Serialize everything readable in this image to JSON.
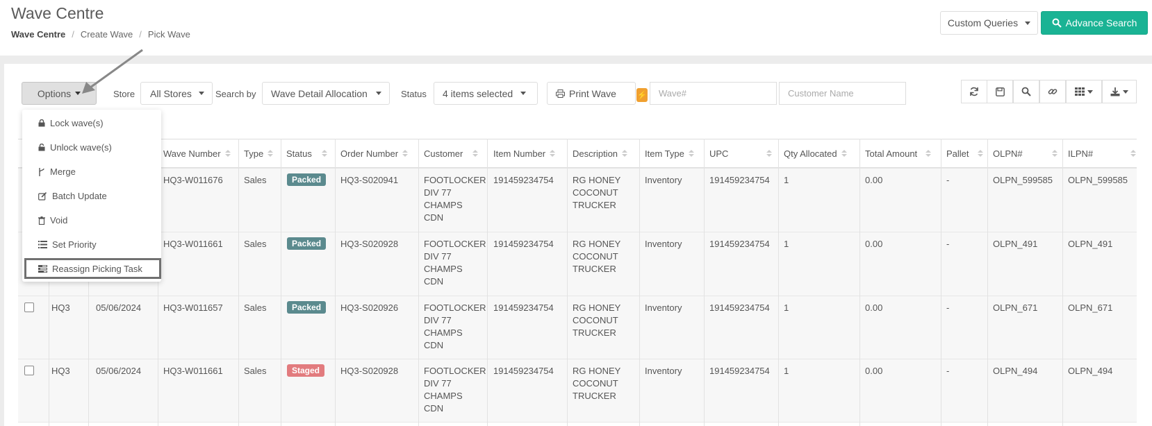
{
  "header": {
    "title": "Wave Centre",
    "breadcrumb": [
      "Wave Centre",
      "Create Wave",
      "Pick Wave"
    ],
    "custom_queries_label": "Custom Queries",
    "advance_search_label": "Advance Search"
  },
  "toolbar": {
    "options_label": "Options",
    "store_label": "Store",
    "store_value": "All Stores",
    "search_by_label": "Search by",
    "search_by_value": "Wave Detail Allocation",
    "status_label": "Status",
    "status_value": "4 items selected",
    "print_wave_label": "Print Wave",
    "wave_placeholder": "Wave#",
    "customer_placeholder": "Customer Name"
  },
  "options_menu": [
    {
      "label": "Lock wave(s)",
      "icon": "lock-icon"
    },
    {
      "label": "Unlock wave(s)",
      "icon": "unlock-icon"
    },
    {
      "label": "Merge",
      "icon": "merge-icon"
    },
    {
      "label": "Batch Update",
      "icon": "edit-icon"
    },
    {
      "label": "Void",
      "icon": "trash-icon"
    },
    {
      "label": "Set Priority",
      "icon": "list-icon"
    },
    {
      "label": "Reassign Picking Task",
      "icon": "tasks-icon"
    }
  ],
  "table": {
    "columns": [
      "Wave Number",
      "Type",
      "Status",
      "Order Number",
      "Customer",
      "Item Number",
      "Description",
      "Item Type",
      "UPC",
      "Qty Allocated",
      "Total Amount",
      "Pallet",
      "OLPN#",
      "ILPN#"
    ],
    "rows": [
      {
        "store": "",
        "date": "",
        "wave": "HQ3-W011676",
        "type": "Sales",
        "status": "Packed",
        "order": "HQ3-S020941",
        "customer": [
          "FOOTLOCKER",
          "DIV 77",
          "CHAMPS",
          "CDN"
        ],
        "item": "191459234754",
        "description": [
          "RG HONEY",
          "COCONUT",
          "TRUCKER"
        ],
        "item_type": "Inventory",
        "upc": "191459234754",
        "qty": "1",
        "amount": "0.00",
        "pallet": "-",
        "olpn": "OLPN_599585",
        "ilpn": "OLPN_599585"
      },
      {
        "store": "",
        "date": "",
        "wave": "HQ3-W011661",
        "type": "Sales",
        "status": "Packed",
        "order": "HQ3-S020928",
        "customer": [
          "FOOTLOCKER",
          "DIV 77",
          "CHAMPS",
          "CDN"
        ],
        "item": "191459234754",
        "description": [
          "RG HONEY",
          "COCONUT",
          "TRUCKER"
        ],
        "item_type": "Inventory",
        "upc": "191459234754",
        "qty": "1",
        "amount": "0.00",
        "pallet": "-",
        "olpn": "OLPN_491",
        "ilpn": "OLPN_491"
      },
      {
        "store": "HQ3",
        "date": "05/06/2024",
        "wave": "HQ3-W011657",
        "type": "Sales",
        "status": "Packed",
        "order": "HQ3-S020926",
        "customer": [
          "FOOTLOCKER",
          "DIV 77",
          "CHAMPS",
          "CDN"
        ],
        "item": "191459234754",
        "description": [
          "RG HONEY",
          "COCONUT",
          "TRUCKER"
        ],
        "item_type": "Inventory",
        "upc": "191459234754",
        "qty": "1",
        "amount": "0.00",
        "pallet": "-",
        "olpn": "OLPN_671",
        "ilpn": "OLPN_671"
      },
      {
        "store": "HQ3",
        "date": "05/06/2024",
        "wave": "HQ3-W011661",
        "type": "Sales",
        "status": "Staged",
        "order": "HQ3-S020928",
        "customer": [
          "FOOTLOCKER",
          "DIV 77",
          "CHAMPS",
          "CDN"
        ],
        "item": "191459234754",
        "description": [
          "RG HONEY",
          "COCONUT",
          "TRUCKER"
        ],
        "item_type": "Inventory",
        "upc": "191459234754",
        "qty": "1",
        "amount": "0.00",
        "pallet": "-",
        "olpn": "OLPN_494",
        "ilpn": "OLPN_494"
      }
    ]
  },
  "colors": {
    "accent": "#1ab394",
    "packed": "#5b8a8e",
    "staged": "#e27b7e"
  }
}
